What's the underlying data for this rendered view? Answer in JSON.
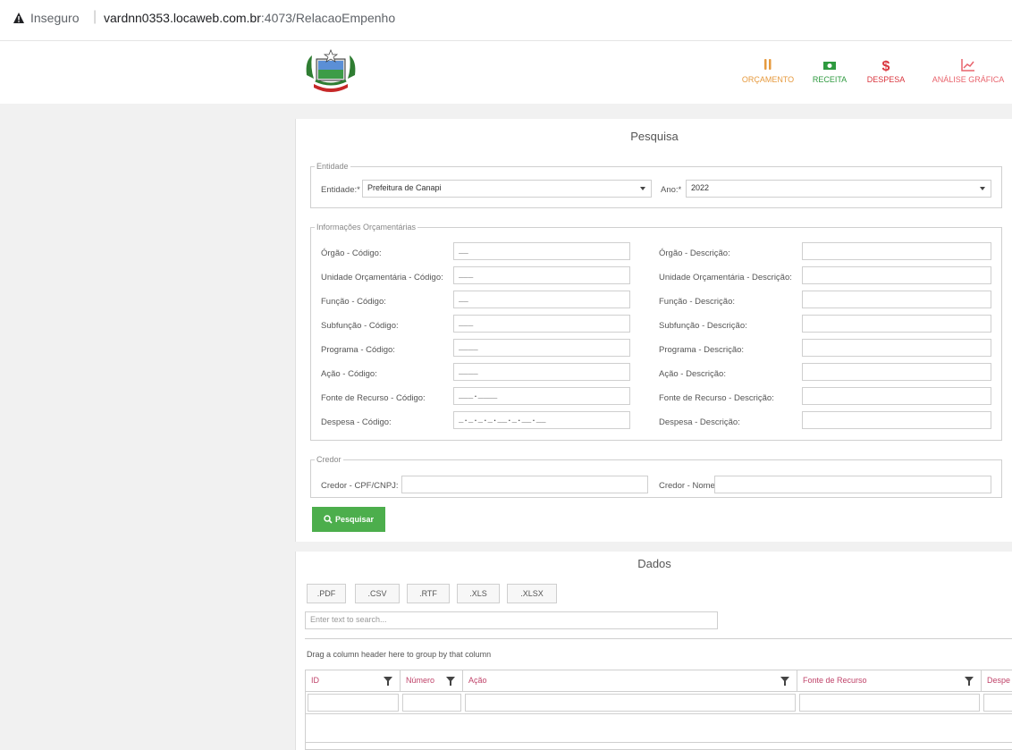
{
  "browser": {
    "security_label": "Inseguro",
    "url_host": "vardnn0353.locaweb.com.br",
    "url_path": ":4073/RelacaoEmpenho"
  },
  "nav": {
    "items": [
      {
        "label": "ORÇAMENTO",
        "color": "#e69a3e",
        "icon": "budget-icon"
      },
      {
        "label": "RECEITA",
        "color": "#2e9a3f",
        "icon": "money-icon"
      },
      {
        "label": "DESPESA",
        "color": "#d9363e",
        "icon": "dollar-icon"
      },
      {
        "label": "ANÁLISE GRÁFICA",
        "color": "#e8636c",
        "icon": "chart-icon"
      }
    ]
  },
  "search_panel": {
    "title": "Pesquisa",
    "entidade": {
      "legend": "Entidade",
      "entidade_label": "Entidade:*",
      "entidade_value": "Prefeitura de Canapi",
      "ano_label": "Ano:*",
      "ano_value": "2022"
    },
    "info": {
      "legend": "Informações Orçamentárias",
      "rows": [
        {
          "code_label": "Órgão - Código:",
          "code_value": "__",
          "desc_label": "Órgão - Descrição:"
        },
        {
          "code_label": "Unidade Orçamentária - Código:",
          "code_value": "___",
          "desc_label": "Unidade Orçamentária - Descrição:"
        },
        {
          "code_label": "Função - Código:",
          "code_value": "__",
          "desc_label": "Função - Descrição:"
        },
        {
          "code_label": "Subfunção - Código:",
          "code_value": "___",
          "desc_label": "Subfunção - Descrição:"
        },
        {
          "code_label": "Programa - Código:",
          "code_value": "____",
          "desc_label": "Programa - Descrição:"
        },
        {
          "code_label": "Ação - Código:",
          "code_value": "____",
          "desc_label": "Ação - Descrição:"
        },
        {
          "code_label": "Fonte de Recurso - Código:",
          "code_value": "___.____",
          "desc_label": "Fonte de Recurso - Descrição:"
        },
        {
          "code_label": "Despesa - Código:",
          "code_value": "_._._._.__._.__.__",
          "desc_label": "Despesa - Descrição:"
        }
      ]
    },
    "credor": {
      "legend": "Credor",
      "cpf_label": "Credor - CPF/CNPJ:",
      "nome_label": "Credor - Nome:"
    },
    "search_button": "Pesquisar"
  },
  "data_panel": {
    "title": "Dados",
    "exports": [
      ".PDF",
      ".CSV",
      ".RTF",
      ".XLS",
      ".XLSX"
    ],
    "search_placeholder": "Enter text to search...",
    "group_hint": "Drag a column header here to group by that column",
    "columns": [
      "ID",
      "Número",
      "Ação",
      "Fonte de Recurso",
      "Despe"
    ]
  }
}
